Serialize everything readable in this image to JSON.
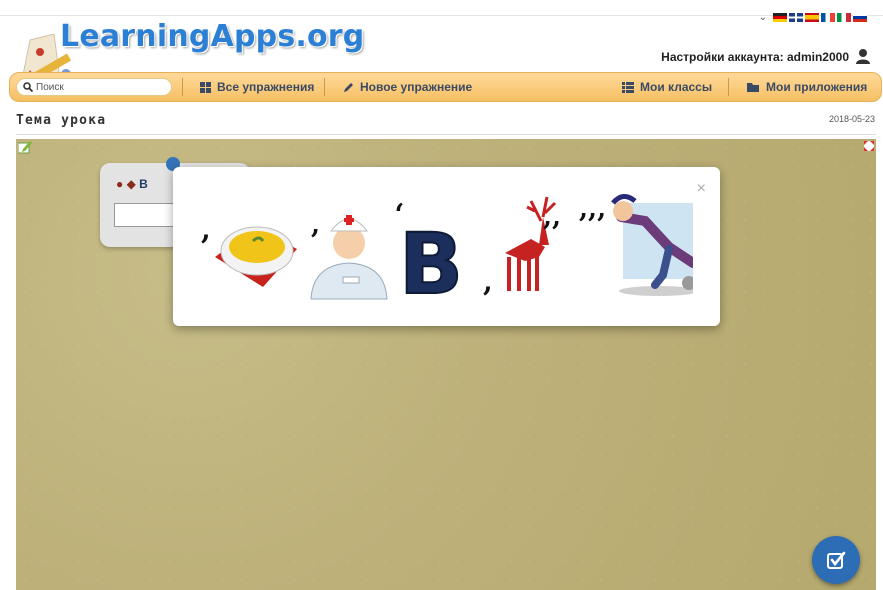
{
  "brand": {
    "logo_text": "LearningApps.org"
  },
  "languages": [
    "de",
    "en",
    "es",
    "fr",
    "it",
    "ru"
  ],
  "account": {
    "label": "Настройки аккаунта: admin2000"
  },
  "nav": {
    "search_placeholder": "Поиск",
    "items": [
      {
        "label": "Все упражнения",
        "icon": "grid-icon"
      },
      {
        "label": "Новое упражнение",
        "icon": "pencil-icon"
      },
      {
        "label": "Мои классы",
        "icon": "list-icon"
      },
      {
        "label": "Мои приложения",
        "icon": "folder-icon"
      }
    ]
  },
  "lesson": {
    "title": "Тема урока",
    "date": "2018-05-23"
  },
  "modal": {
    "close_label": "×",
    "rebus_glyphs": [
      "soup-bowl",
      "nurse",
      "letter-b",
      "deer",
      "running-man"
    ],
    "letter": "В",
    "commas": [
      ",",
      ",",
      ",",
      ",",
      ",,",
      ",,,"
    ]
  },
  "colors": {
    "nav_bg": "#f6c063",
    "logo": "#2b7fd4",
    "app_bg": "#bfb27b",
    "check": "#2d6db5"
  }
}
